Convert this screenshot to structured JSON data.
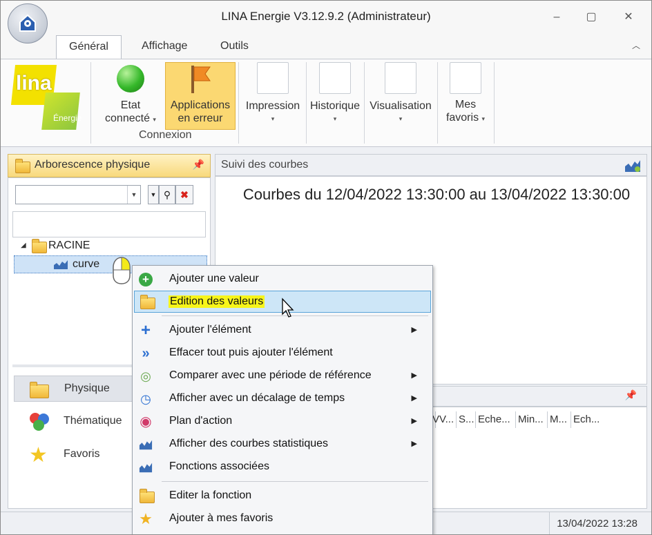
{
  "window": {
    "title": "LINA Energie  V3.12.9.2  (Administrateur)",
    "controls": [
      "–",
      "▢",
      "✕"
    ]
  },
  "ribbon_tabs": [
    "Général",
    "Affichage",
    "Outils"
  ],
  "logo": {
    "word": "lina",
    "sub": "Énergie"
  },
  "ribbon": {
    "etat": {
      "label1": "Etat",
      "label2": "connecté",
      "arrow": "▾"
    },
    "applications": {
      "label1": "Applications",
      "label2": "en erreur"
    },
    "group_connexion": "Connexion",
    "impression": {
      "label": "Impression",
      "arrow": "▾"
    },
    "historique": {
      "label": "Historique",
      "arrow": "▾"
    },
    "visualisation": {
      "label": "Visualisation",
      "arrow": "▾"
    },
    "favoris": {
      "label1": "Mes",
      "label2": "favoris",
      "arrow": "▾"
    }
  },
  "left_panel": {
    "title": "Arborescence physique",
    "tree_root": "RACINE",
    "tree_child": "curve",
    "nav": [
      "Physique",
      "Thématique",
      "Favoris"
    ]
  },
  "right_panel": {
    "title": "Suivi des courbes",
    "curve_title": "Courbes du 12/04/2022 13:30:00 au 13/04/2022 13:30:00",
    "lower_columns": [
      "V",
      "V...",
      "S...",
      "Eche...",
      "Min...",
      "M...",
      "Ech..."
    ]
  },
  "status_bar": {
    "datetime": "13/04/2022 13:28"
  },
  "context_menu": {
    "items": [
      {
        "label": "Ajouter une valeur",
        "icon": "add-circle-icon",
        "submenu": false
      },
      {
        "label": "Edition des valeurs",
        "icon": "folder-edit-icon",
        "submenu": false,
        "highlighted": true
      },
      {
        "label": "Ajouter l'élément",
        "icon": "plus-icon",
        "submenu": true
      },
      {
        "label": "Effacer tout puis ajouter l'élément",
        "icon": "double-chevron-icon",
        "submenu": false
      },
      {
        "label": "Comparer avec une période de référence",
        "icon": "compare-icon",
        "submenu": true
      },
      {
        "label": "Afficher avec un décalage de temps",
        "icon": "time-shift-icon",
        "submenu": true
      },
      {
        "label": "Plan d'action",
        "icon": "target-icon",
        "submenu": true
      },
      {
        "label": "Afficher des courbes statistiques",
        "icon": "chart-icon",
        "submenu": true
      },
      {
        "label": "Fonctions associées",
        "icon": "chart-icon",
        "submenu": false
      },
      {
        "label": "Editer la fonction",
        "icon": "folder-edit-icon",
        "submenu": false
      },
      {
        "label": "Ajouter à mes favoris",
        "icon": "star-icon",
        "submenu": false
      }
    ],
    "submenu_arrow": "▶"
  },
  "colors": {
    "accent_highlight": "#f7f51a",
    "selection": "#cde6f7",
    "ribbon_active": "#fbd872"
  }
}
